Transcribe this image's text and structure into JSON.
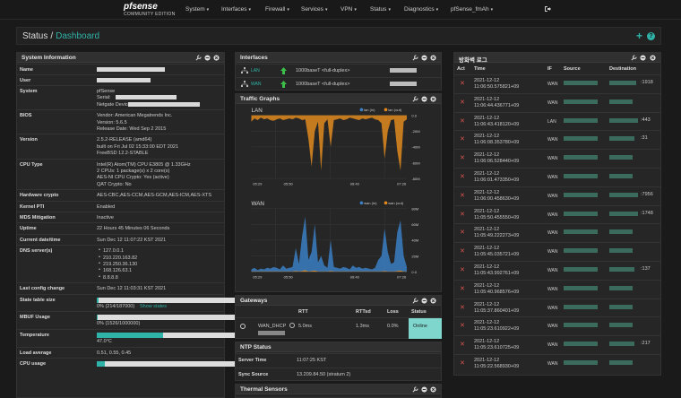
{
  "nav": {
    "logo_brand": "pfsense",
    "logo_edition": "COMMUNITY EDITION",
    "menu": [
      "System",
      "Interfaces",
      "Firewall",
      "Services",
      "VPN",
      "Status",
      "Diagnostics",
      "pfSense_fmAh"
    ]
  },
  "topbar": {
    "crumb_root": "Status",
    "crumb_sep": "/",
    "crumb_page": "Dashboard",
    "add_label": "+",
    "help_label": "?"
  },
  "sysinfo": {
    "title": "System Information",
    "rows": [
      {
        "label": "Name"
      },
      {
        "label": "User"
      },
      {
        "label": "System",
        "lines": [
          "pfSense",
          "Serial:",
          "Netgate Device ID:"
        ]
      },
      {
        "label": "BIOS",
        "lines": [
          "Vendor: American Megatrends Inc.",
          "Version: 5.6.5",
          "Release Date: Wed Sep 2 2015"
        ]
      },
      {
        "label": "Version",
        "lines": [
          "2.5.2-RELEASE (amd64)",
          "built on Fri Jul 02 15:33:00 EDT 2021",
          "FreeBSD 12.2-STABLE"
        ]
      },
      {
        "label": "CPU Type",
        "lines": [
          "Intel(R) Atom(TM) CPU E3805 @ 1.33GHz",
          "2 CPUs: 1 package(s) x 2 core(s)",
          "AES-NI CPU Crypto: Yes (active)",
          "QAT Crypto: No"
        ]
      },
      {
        "label": "Hardware crypto",
        "lines": [
          "AES-CBC,AES-CCM,AES-GCM,AES-ICM,AES-XTS"
        ]
      },
      {
        "label": "Kernel PTI",
        "lines": [
          "Enabled"
        ]
      },
      {
        "label": "MDS Mitigation",
        "lines": [
          "Inactive"
        ]
      },
      {
        "label": "Uptime",
        "lines": [
          "22 Hours 45 Minutes 06 Seconds"
        ]
      },
      {
        "label": "Current date/time",
        "lines": [
          "Sun Dec 12 11:07:22 KST 2021"
        ]
      },
      {
        "label": "DNS server(s)",
        "lines": [
          "127.0.0.1",
          "210.220.163.82",
          "219.250.36.130",
          "168.126.63.1",
          "8.8.8.8"
        ]
      },
      {
        "label": "Last config change",
        "lines": [
          "Sun Dec 12 11:03:31 KST 2021"
        ]
      },
      {
        "label": "State table size",
        "note": "0% (214/187000)",
        "link": "Show states",
        "fill": 0.01
      },
      {
        "label": "MBUF Usage",
        "note": "0% (1526/1000000)",
        "fill": 0.005
      },
      {
        "label": "Temperature",
        "note": "47.0°C",
        "fill": 0.47
      },
      {
        "label": "Load average",
        "lines": [
          "0.51, 0.55, 0.45"
        ]
      },
      {
        "label": "CPU usage",
        "fill": 0.06
      }
    ]
  },
  "interfaces": {
    "title": "Interfaces",
    "rows": [
      {
        "name": "LAN",
        "media": "1000baseT <full-duplex>"
      },
      {
        "name": "WAN",
        "media": "1000baseT <full-duplex>"
      }
    ]
  },
  "traffic": {
    "title": "Traffic Graphs"
  },
  "chart_data": [
    {
      "type": "area",
      "title": "LAN",
      "series": [
        {
          "name": "lan (in)",
          "color": "#3b7fc4"
        },
        {
          "name": "lan (out)",
          "color": "#e08a1e"
        }
      ],
      "x_ticks": [
        "05:29",
        "05:50",
        "06:40",
        "07:26"
      ],
      "y_ticks": [
        "0.0",
        "-20M",
        "-40M",
        "-60M",
        "-80M"
      ],
      "in_values": [
        0,
        0,
        0,
        0,
        0,
        0,
        0,
        0,
        0,
        0,
        0,
        0,
        0,
        0,
        0,
        0,
        0,
        0,
        0,
        0,
        0,
        0,
        0,
        0,
        0,
        0,
        0,
        0,
        0,
        0,
        0,
        0,
        0,
        0,
        0,
        0,
        0,
        0,
        0,
        0,
        0,
        0,
        0,
        0,
        0,
        0,
        0,
        0,
        0,
        0
      ],
      "out_values": [
        -8,
        -4,
        -6,
        -3,
        -5,
        -4,
        -6,
        -7,
        -5,
        -4,
        -6,
        -5,
        -4,
        -5,
        -3,
        -4,
        -6,
        -5,
        -30,
        -65,
        -20,
        -8,
        -70,
        -10,
        -5,
        -40,
        -6,
        -5,
        -4,
        -6,
        -5,
        -3,
        -4,
        -5,
        -6,
        -4,
        -5,
        -4,
        -3,
        -5,
        -6,
        -10,
        -55,
        -20,
        -6,
        -5,
        -45,
        -70,
        -8,
        -5
      ]
    },
    {
      "type": "area",
      "title": "WAN",
      "series": [
        {
          "name": "wan (in)",
          "color": "#3b7fc4"
        },
        {
          "name": "wan (out)",
          "color": "#e08a1e"
        }
      ],
      "x_ticks": [
        "05:29",
        "05:50",
        "06:40",
        "07:26"
      ],
      "y_ticks": [
        "80M",
        "60M",
        "40M",
        "20M",
        "0.0"
      ],
      "in_values": [
        3,
        5,
        2,
        4,
        3,
        5,
        4,
        6,
        5,
        3,
        8,
        4,
        5,
        6,
        30,
        10,
        45,
        70,
        15,
        25,
        60,
        12,
        20,
        8,
        5,
        40,
        6,
        5,
        4,
        6,
        5,
        3,
        8,
        5,
        6,
        4,
        5,
        4,
        3,
        5,
        15,
        20,
        55,
        25,
        10,
        12,
        50,
        65,
        20,
        6
      ],
      "out_values": [
        0.5,
        0.5,
        0.5,
        0.5,
        0.5,
        0.5,
        0.5,
        0.5,
        0.5,
        0.5,
        0.5,
        0.5,
        0.5,
        0.5,
        1,
        0.5,
        1,
        2,
        0.5,
        1,
        1.5,
        0.5,
        0.5,
        0.5,
        0.5,
        1,
        0.5,
        0.5,
        0.5,
        0.5,
        0.5,
        0.5,
        0.5,
        0.5,
        0.5,
        0.5,
        0.5,
        0.5,
        0.5,
        0.5,
        0.5,
        0.5,
        1,
        0.5,
        0.5,
        0.5,
        1,
        1.5,
        0.5,
        0.5
      ]
    }
  ],
  "gateways": {
    "title": "Gateways",
    "headers": [
      "RTT",
      "RTTsd",
      "Loss",
      "Status"
    ],
    "row": {
      "name": "WAN_DHCP",
      "rtt": "5.0ms",
      "rttsd": "1.3ms",
      "loss": "0.0%",
      "status": "Online"
    }
  },
  "ntp": {
    "title": "NTP Status",
    "rows": [
      {
        "label": "Server Time",
        "value": "11:07:25 KST"
      },
      {
        "label": "Sync Source",
        "value": "13.209.84.50 (stratum 2)"
      }
    ]
  },
  "thermal": {
    "title": "Thermal Sensors"
  },
  "firewall": {
    "title": "방화벽 로그",
    "headers": [
      "Act",
      "Time",
      "IF",
      "Source",
      "Destination"
    ],
    "rows": [
      {
        "date": "2021-12-12",
        "time": "11:06:50.575821+09",
        "if": "WAN",
        "dst": ":1918"
      },
      {
        "date": "2021-12-12",
        "time": "11:06:44.436771+09",
        "if": "WAN",
        "dst": ""
      },
      {
        "date": "2021-12-12",
        "time": "11:06:43.418120+09",
        "if": "LAN",
        "dst": ":443"
      },
      {
        "date": "2021-12-12",
        "time": "11:06:08.353780+09",
        "if": "WAN",
        "dst": ":31"
      },
      {
        "date": "2021-12-12",
        "time": "11:06:06.528440+09",
        "if": "WAN",
        "dst": ""
      },
      {
        "date": "2021-12-12",
        "time": "11:06:01.473350+09",
        "if": "WAN",
        "dst": ""
      },
      {
        "date": "2021-12-12",
        "time": "11:06:00.458630+09",
        "if": "WAN",
        "dst": ":7956"
      },
      {
        "date": "2021-12-12",
        "time": "11:05:50.455550+09",
        "if": "WAN",
        "dst": ":1748"
      },
      {
        "date": "2021-12-12",
        "time": "11:05:49.222273+09",
        "if": "WAN",
        "dst": ""
      },
      {
        "date": "2021-12-12",
        "time": "11:05:45.035721+09",
        "if": "WAN",
        "dst": ""
      },
      {
        "date": "2021-12-12",
        "time": "11:05:43.992761+09",
        "if": "WAN",
        "dst": ":137"
      },
      {
        "date": "2021-12-12",
        "time": "11:05:40.968576+09",
        "if": "WAN",
        "dst": ""
      },
      {
        "date": "2021-12-12",
        "time": "11:05:37.860401+09",
        "if": "WAN",
        "dst": ""
      },
      {
        "date": "2021-12-12",
        "time": "11:05:23.610922+09",
        "if": "WAN",
        "dst": ""
      },
      {
        "date": "2021-12-12",
        "time": "11:05:23.610725+09",
        "if": "WAN",
        "dst": ":217"
      },
      {
        "date": "2021-12-12",
        "time": "11:05:22.568930+09",
        "if": "WAN",
        "dst": ""
      }
    ]
  },
  "colors": {
    "accent": "#2fb3a8",
    "in": "#3b7fc4",
    "out": "#e08a1e",
    "up_arrow": "#3cbf4a",
    "block": "#d9534f"
  }
}
